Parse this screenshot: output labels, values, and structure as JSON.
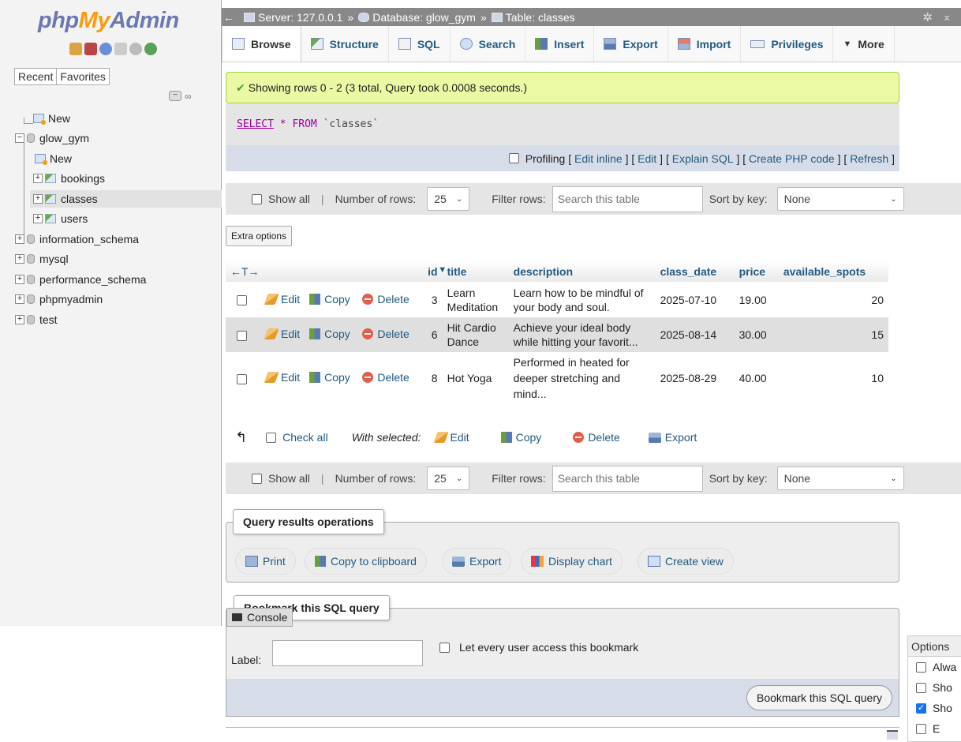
{
  "logo": {
    "php": "php",
    "my": "My",
    "admin": "Admin"
  },
  "nav_tabs": [
    "Recent",
    "Favorites"
  ],
  "tree": {
    "new_root": "New",
    "glow_gym": "glow_gym",
    "glow_new": "New",
    "bookings": "bookings",
    "classes": "classes",
    "users": "users",
    "information_schema": "information_schema",
    "mysql": "mysql",
    "performance_schema": "performance_schema",
    "phpmyadmin": "phpmyadmin",
    "test": "test"
  },
  "breadcrumb": {
    "server": "Server: 127.0.0.1",
    "database": "Database: glow_gym",
    "table": "Table: classes",
    "sep": "»"
  },
  "tabs": [
    "Browse",
    "Structure",
    "SQL",
    "Search",
    "Insert",
    "Export",
    "Import",
    "Privileges",
    "More"
  ],
  "success_message": "Showing rows 0 - 2 (3 total, Query took 0.0008 seconds.)",
  "sql": {
    "select": "SELECT",
    "star": "*",
    "from": "FROM",
    "table": "`classes`"
  },
  "profiling": {
    "label": "Profiling",
    "links": [
      "Edit inline",
      "Edit",
      "Explain SQL",
      "Create PHP code",
      "Refresh"
    ]
  },
  "navbar": {
    "show_all": "Show all",
    "number_of_rows": "Number of rows:",
    "rows_value": "25",
    "filter_rows": "Filter rows:",
    "search_placeholder": "Search this table",
    "sort_by_key": "Sort by key:",
    "sort_value": "None"
  },
  "extra_options": "Extra options",
  "table": {
    "arrows": "←T→",
    "columns": [
      "id",
      "title",
      "description",
      "class_date",
      "price",
      "available_spots"
    ],
    "actions": {
      "edit": "Edit",
      "copy": "Copy",
      "delete": "Delete"
    },
    "rows": [
      {
        "id": "3",
        "title": "Learn Meditation",
        "description": "Learn how to be mindful of your body and soul.",
        "class_date": "2025-07-10",
        "price": "19.00",
        "available_spots": "20"
      },
      {
        "id": "6",
        "title": "Hit Cardio Dance",
        "description": "Achieve your ideal body while hitting your favorit...",
        "class_date": "2025-08-14",
        "price": "30.00",
        "available_spots": "15"
      },
      {
        "id": "8",
        "title": "Hot Yoga",
        "description": "Performed in heated for deeper stretching and mind...",
        "class_date": "2025-08-29",
        "price": "40.00",
        "available_spots": "10"
      }
    ]
  },
  "bulk": {
    "check_all": "Check all",
    "with_selected": "With selected:",
    "edit": "Edit",
    "copy": "Copy",
    "delete": "Delete",
    "export": "Export"
  },
  "query_ops": {
    "legend": "Query results operations",
    "print": "Print",
    "copy_clipboard": "Copy to clipboard",
    "export": "Export",
    "display_chart": "Display chart",
    "create_view": "Create view"
  },
  "bookmark": {
    "legend": "Bookmark this SQL query",
    "label": "Label:",
    "every_user": "Let every user access this bookmark",
    "submit": "Bookmark this SQL query"
  },
  "console": "Console",
  "options_panel": {
    "title": "Options",
    "items": [
      "Alwa",
      "Sho",
      "Sho",
      "E"
    ],
    "checked": [
      false,
      false,
      true,
      false
    ]
  },
  "colors": {
    "link": "#235a81",
    "success_bg": "#ebf8a4",
    "topbar": "#888888"
  }
}
